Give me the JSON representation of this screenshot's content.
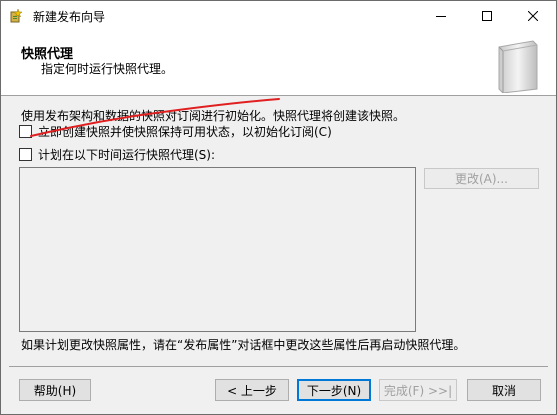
{
  "window": {
    "title": "新建发布向导",
    "icons": [
      "wizard-icon",
      "minimize-icon",
      "maximize-icon",
      "close-icon"
    ]
  },
  "header": {
    "title": "快照代理",
    "subtitle": "指定何时运行快照代理。"
  },
  "body": {
    "description": "使用发布架构和数据的快照对订阅进行初始化。快照代理将创建该快照。",
    "options": [
      {
        "label": "立即创建快照并使快照保持可用状态，以初始化订阅(C)",
        "checked": false
      },
      {
        "label": "计划在以下时间运行快照代理(S):",
        "checked": false
      }
    ],
    "change_button": "更改(A)...",
    "note": "如果计划更改快照属性，请在“发布属性”对话框中更改这些属性后再启动快照代理。"
  },
  "footer": {
    "help": "帮助(H)",
    "back": "< 上一步",
    "next": "下一步(N)",
    "finish": "完成(F) >>|",
    "cancel": "取消"
  },
  "colors": {
    "accent": "#0078d7",
    "annotation": "#e02020"
  }
}
